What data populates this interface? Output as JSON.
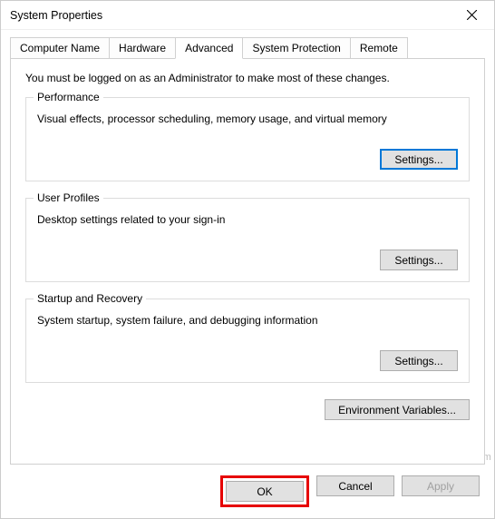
{
  "window": {
    "title": "System Properties"
  },
  "tabs": {
    "computer_name": "Computer Name",
    "hardware": "Hardware",
    "advanced": "Advanced",
    "system_protection": "System Protection",
    "remote": "Remote"
  },
  "admin_note": "You must be logged on as an Administrator to make most of these changes.",
  "performance": {
    "title": "Performance",
    "desc": "Visual effects, processor scheduling, memory usage, and virtual memory",
    "settings_btn": "Settings..."
  },
  "user_profiles": {
    "title": "User Profiles",
    "desc": "Desktop settings related to your sign-in",
    "settings_btn": "Settings..."
  },
  "startup_recovery": {
    "title": "Startup and Recovery",
    "desc": "System startup, system failure, and debugging information",
    "settings_btn": "Settings..."
  },
  "env_vars_btn": "Environment Variables...",
  "buttons": {
    "ok": "OK",
    "cancel": "Cancel",
    "apply": "Apply"
  },
  "watermark": "wsxdn.com"
}
